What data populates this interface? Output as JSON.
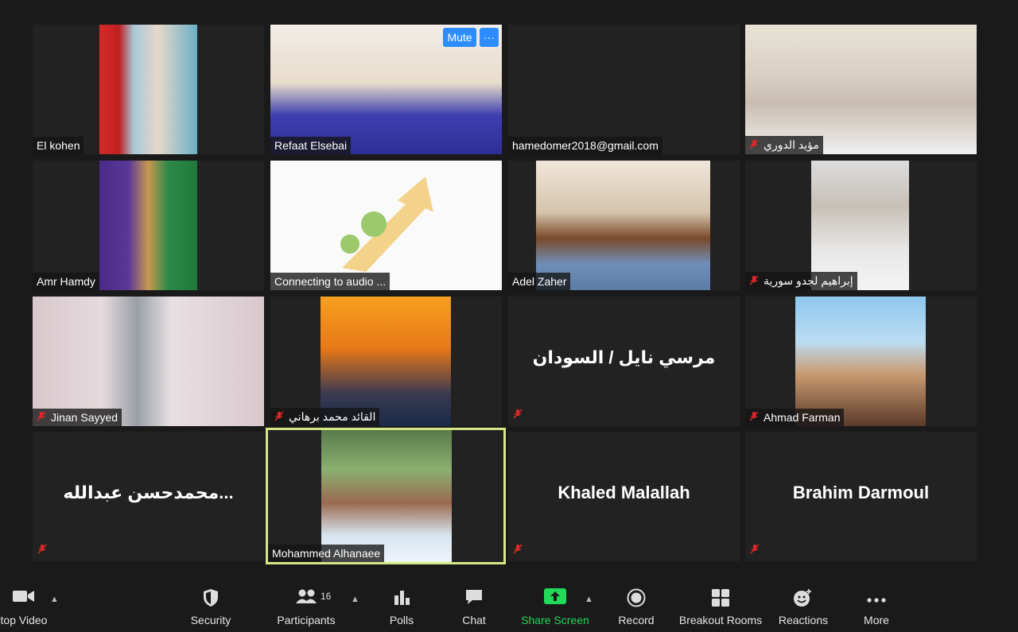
{
  "participants": [
    {
      "name": "El kohen"
    },
    {
      "name": "Refaat Elsebai"
    },
    {
      "name": "hamedomer2018@gmail.com"
    },
    {
      "name": "مؤيد الدوري"
    },
    {
      "name": "Amr Hamdy"
    },
    {
      "name": "Connecting to audio ..."
    },
    {
      "name": "Adel Zaher"
    },
    {
      "name": "إبراهيم لجدو سورية"
    },
    {
      "name": "Jinan Sayyed"
    },
    {
      "name": "القائد محمد برهاني"
    },
    {
      "name": "مرسي نايل / السودان"
    },
    {
      "name": "Ahmad Farman"
    },
    {
      "name": "محمدحسن عبدالله..."
    },
    {
      "name": "Mohammed Alhanaee"
    },
    {
      "name": "Khaled Malallah"
    },
    {
      "name": "Brahim Darmoul"
    }
  ],
  "tile_controls": {
    "mute": "Mute",
    "more": "···"
  },
  "toolbar": {
    "stop_video": "top Video",
    "security": "Security",
    "participants": "Participants",
    "participants_count": "16",
    "polls": "Polls",
    "chat": "Chat",
    "share_screen": "Share Screen",
    "record": "Record",
    "breakout_rooms": "Breakout Rooms",
    "reactions": "Reactions",
    "more": "More"
  },
  "colors": {
    "share": "#23d959",
    "accent": "#2d8cff",
    "active_speaker": "#d4e887",
    "muted": "#e02828"
  }
}
